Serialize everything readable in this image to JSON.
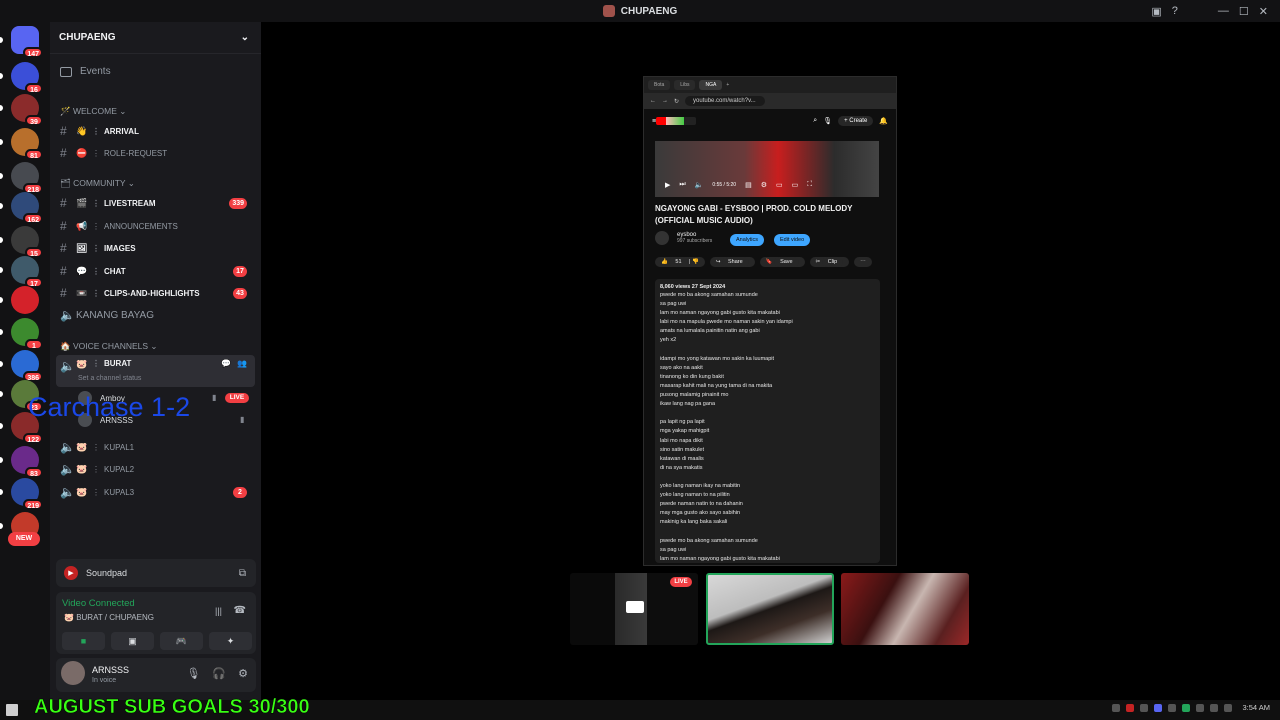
{
  "window": {
    "title": "CHUPAENG"
  },
  "rail": {
    "servers": [
      {
        "badge": "147",
        "color": "#5865f2"
      },
      {
        "badge": "16",
        "color": "#3b4fd8"
      },
      {
        "badge": "39",
        "color": "#8b2b2b"
      },
      {
        "badge": "81",
        "color": "#b86f2c"
      },
      {
        "badge": "218",
        "color": "#474a50"
      },
      {
        "badge": "162",
        "color": "#2f4a7a"
      },
      {
        "badge": "15",
        "color": "#3a3a3a"
      },
      {
        "badge": "17",
        "color": "#3f5a6a"
      },
      {
        "badge": "",
        "color": "#d4222a"
      },
      {
        "badge": "1",
        "color": "#3c8a2e"
      },
      {
        "badge": "386",
        "color": "#2a6ad4"
      },
      {
        "badge": "23",
        "color": "#5a7a3a"
      },
      {
        "badge": "122",
        "color": "#8a2a2a"
      },
      {
        "badge": "83",
        "color": "#6a2a8a"
      },
      {
        "badge": "219",
        "color": "#2a4aa0"
      },
      {
        "badge": "",
        "color": "#c23a2a"
      }
    ],
    "new_label": "NEW"
  },
  "sidebar": {
    "guild_name": "CHUPAENG",
    "events_label": "Events",
    "categories": {
      "welcome": "WELCOME",
      "community": "COMMUNITY",
      "voice": "VOICE CHANNELS"
    },
    "channels": {
      "arrival": {
        "emoji": "👋",
        "label": "ARRIVAL"
      },
      "role_request": {
        "emoji": "⛔",
        "label": "ROLE-REQUEST"
      },
      "livestream": {
        "emoji": "🎬",
        "label": "LIVESTREAM",
        "count": "339"
      },
      "announcements": {
        "emoji": "📢",
        "label": "ANNOUNCEMENTS"
      },
      "images": {
        "emoji": "🖼",
        "label": "IMAGES"
      },
      "chat": {
        "emoji": "💬",
        "label": "CHAT",
        "count": "17"
      },
      "clips": {
        "emoji": "📼",
        "label": "CLIPS-AND-HIGHLIGHTS",
        "count": "43"
      },
      "kanang_bayag": {
        "label": "KANANG BAYAG"
      }
    },
    "voice": {
      "burat": {
        "emoji": "🐷",
        "label": "BURAT",
        "status": "Set a channel status"
      },
      "users": [
        {
          "name": "Amboy",
          "live": "LIVE"
        },
        {
          "name": "ARNSSS"
        }
      ],
      "kupal1": {
        "emoji": "🐷",
        "label": "KUPAL1"
      },
      "kupal2": {
        "emoji": "🐷",
        "label": "KUPAL2"
      },
      "kupal3": {
        "emoji": "🐷",
        "label": "KUPAL3",
        "count": "2"
      }
    },
    "overlay_text": "Carchase 1-2"
  },
  "soundpad": {
    "label": "Soundpad"
  },
  "voice_panel": {
    "status": "Video Connected",
    "channel": "BURAT / CHUPAENG"
  },
  "user_panel": {
    "name": "ARNSSS",
    "status": "In voice"
  },
  "stream": {
    "tabs": [
      "Bota",
      "Libs",
      "NGA"
    ],
    "url": "youtube.com/watch?v...",
    "create": "Create",
    "time": "0:55 / 5:20",
    "title": "NGAYONG GABI - EYSBOO | PROD. COLD MELODY (OFFICIAL MUSIC AUDIO)",
    "channel_name": "eysboo",
    "subscribers": "997 subscribers",
    "analytics": "Analytics",
    "edit_video": "Edit video",
    "likes": "51",
    "share": "Share",
    "save": "Save",
    "clip": "Clip",
    "desc_header": "8,060 views  27 Sept 2024",
    "lyrics": [
      "pwede mo ba akong samahan sumunde",
      "sa pag uwi",
      "lam mo naman ngayong gabi gusto kita makatabi",
      "labi mo na mapula pwede mo naman sakin yan idampi",
      "amats na lumalala painitin natin ang gabi",
      "yeh x2",
      "",
      "idampi mo yong katawan mo sakin ka luumapit",
      "sayo ako na aakit",
      "tinanong ko din kung bakit",
      "masarap kahit mali na yung tama di na makita",
      "pusong malamig pinainit mo",
      "ikaw lang nag pa gana",
      "",
      "pa lapit ng pa lapit",
      "mga yakap mahigpit",
      "labi mo napa dikit",
      "sino satin makulet",
      "katawan di maalis",
      "di na sya makatis",
      "",
      "yoko lang naman ikay na mabitin",
      "yoko lang naman to na pilitin",
      "pwede naman natin to na dahanin",
      "may mga gusto ako sayo sabihin",
      "makinig ka lang baka sakali",
      "",
      "pwede mo ba akong samahan sumunde",
      "sa pag uwi",
      "lam mo naman ngayong gabi gusto kita makatabi"
    ]
  },
  "thumbnails": {
    "live": "LIVE"
  },
  "overlay": {
    "sub_goal": "AUGUST SUB GOALS 30/300"
  },
  "taskbar": {
    "clock": "3:54 AM"
  }
}
